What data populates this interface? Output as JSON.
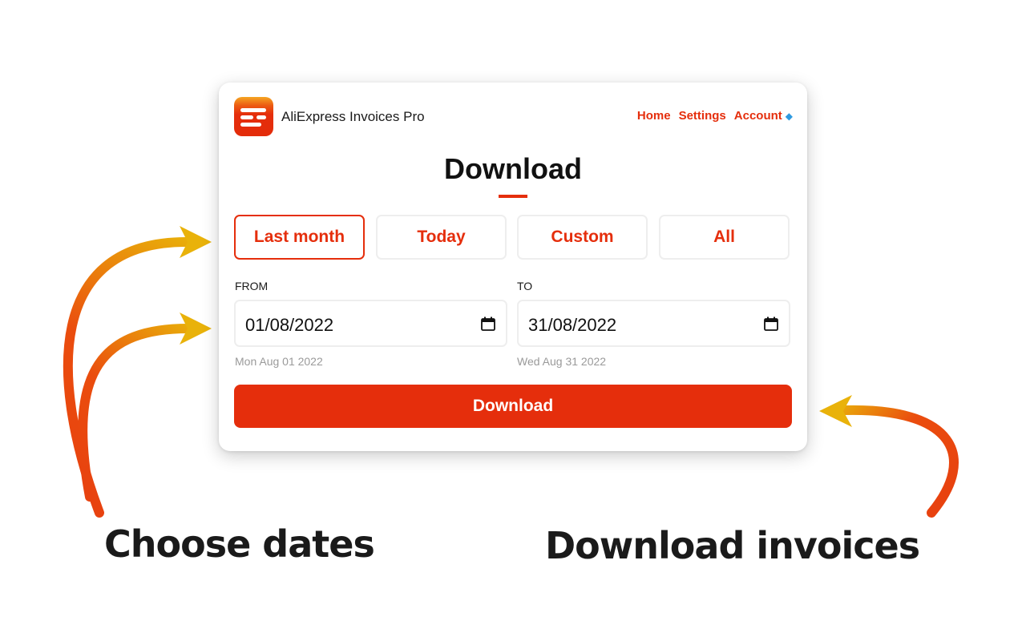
{
  "app": {
    "name": "AliExpress Invoices Pro",
    "logo_icon": "invoice-lines-icon"
  },
  "nav": {
    "home": "Home",
    "settings": "Settings",
    "account": "Account",
    "account_icon": "gem-icon"
  },
  "page": {
    "title": "Download"
  },
  "presets": [
    {
      "label": "Last month",
      "active": true
    },
    {
      "label": "Today",
      "active": false
    },
    {
      "label": "Custom",
      "active": false
    },
    {
      "label": "All",
      "active": false
    }
  ],
  "range": {
    "from": {
      "label": "FROM",
      "value": "01/08/2022",
      "hint": "Mon Aug 01 2022",
      "icon": "calendar-icon"
    },
    "to": {
      "label": "TO",
      "value": "31/08/2022",
      "hint": "Wed Aug 31 2022",
      "icon": "calendar-icon"
    }
  },
  "download_button": {
    "label": "Download"
  },
  "captions": {
    "left": "Choose dates",
    "right": "Download invoices"
  },
  "colors": {
    "accent": "#e52e0c",
    "arrow_start": "#e8420f",
    "arrow_end": "#e9b20a",
    "gem": "#2f9ae0",
    "hint_text": "#9a9a9a",
    "border": "#eeeeee"
  }
}
